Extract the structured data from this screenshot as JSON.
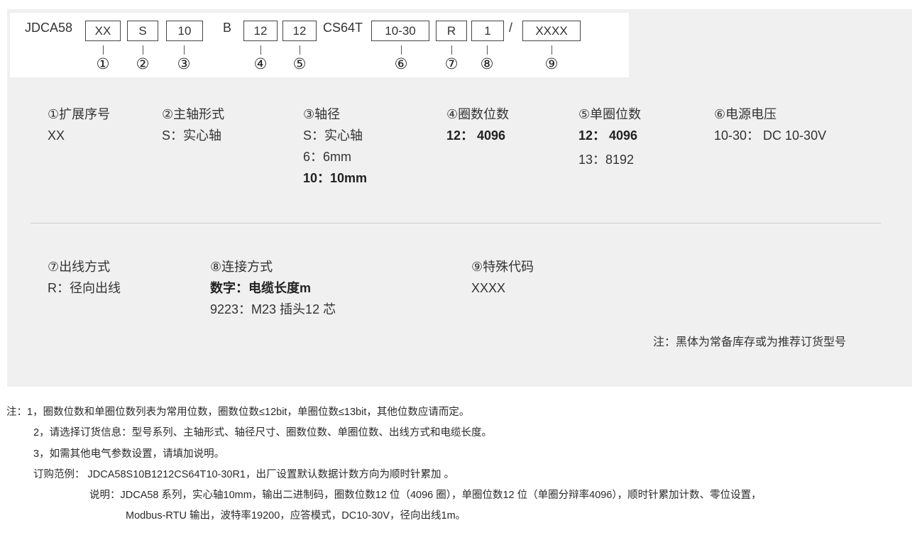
{
  "code_bar": {
    "prefix": "JDCA58",
    "boxes": [
      "XX",
      "S",
      "10",
      "12",
      "12",
      "10-30",
      "R",
      "1",
      "XXXX"
    ],
    "separators": [
      "B",
      "CS64T",
      "/"
    ],
    "markers": [
      "①",
      "②",
      "③",
      "④",
      "⑤",
      "⑥",
      "⑦",
      "⑧",
      "⑨"
    ]
  },
  "sections": {
    "s1": {
      "title": "①扩展序号",
      "lines": [
        "XX"
      ]
    },
    "s2": {
      "title": "②主轴形式",
      "lines": [
        "S：实心轴"
      ]
    },
    "s3": {
      "title": "③轴径",
      "lines": [
        "S：实心轴",
        "6：6mm"
      ],
      "bold": "10：10mm"
    },
    "s4": {
      "title": "④圈数位数",
      "bold": "12：  4096"
    },
    "s5": {
      "title": "⑤单圈位数",
      "bold": "12：  4096",
      "lines": [
        "13：8192"
      ]
    },
    "s6": {
      "title": "⑥电源电压",
      "lines": [
        "10-30：  DC 10-30V"
      ]
    },
    "s7": {
      "title": "⑦出线方式",
      "lines": [
        "R：径向出线"
      ]
    },
    "s8": {
      "title": "⑧连接方式",
      "bold": "数字：电缆长度m",
      "lines": [
        "9223：M23 插头12 芯"
      ]
    },
    "s9": {
      "title": "⑨特殊代码",
      "lines": [
        "XXXX"
      ]
    }
  },
  "panel_note": "注：黑体为常备库存或为推荐订货型号",
  "notes": {
    "n1": "注：1，圈数位数和单圈位数列表为常用位数，圈数位数≤12bit，单圈位数≤13bit，其他位数应请而定。",
    "n2": "2，请选择订货信息：型号系列、主轴形式、轴径尺寸、圈数位数、单圈位数、出线方式和电缆长度。",
    "n3": "3，如需其他电气参数设置，请填加说明。",
    "n4": "订购范例：  JDCA58S10B1212CS64T10-30R1，出厂设置默认数据计数方向为顺时针累加 。",
    "n5": "说明：JDCA58 系列，实心轴10mm，输出二进制码，圈数位数12 位（4096 圈），单圈位数12 位（单圈分辩率4096），顺时针累加计数、零位设置，",
    "n6": "Modbus-RTU 输出，波特率19200，应答模式，DC10-30V，径向出线1m。"
  }
}
